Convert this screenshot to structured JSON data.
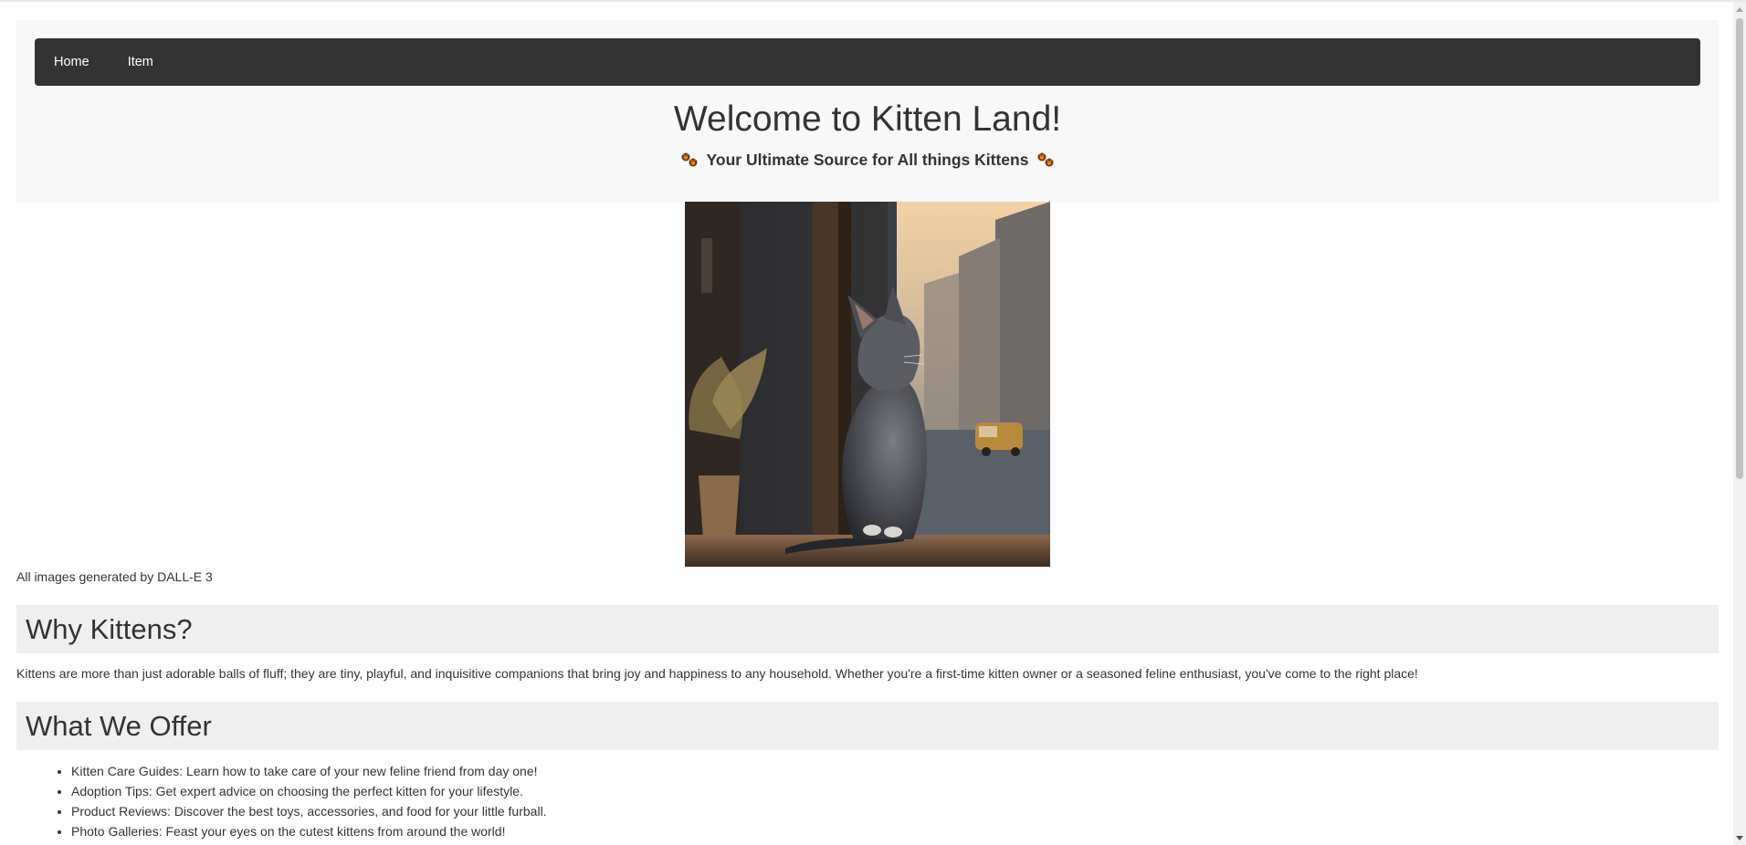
{
  "nav": {
    "items": [
      {
        "label": "Home"
      },
      {
        "label": "Item"
      }
    ]
  },
  "header": {
    "title": "Welcome to Kitten Land!",
    "tagline": "Your Ultimate Source for All things Kittens"
  },
  "hero": {
    "credit": "All images generated by DALL-E 3"
  },
  "why": {
    "heading": "Why Kittens?",
    "text": "Kittens are more than just adorable balls of fluff; they are tiny, playful, and inquisitive companions that bring joy and happiness to any household. Whether you're a first-time kitten owner or a seasoned feline enthusiast, you've come to the right place!"
  },
  "offer": {
    "heading": "What We Offer",
    "items": [
      "Kitten Care Guides: Learn how to take care of your new feline friend from day one!",
      "Adoption Tips: Get expert advice on choosing the perfect kitten for your lifestyle.",
      "Product Reviews: Discover the best toys, accessories, and food for your little furball.",
      "Photo Galleries: Feast your eyes on the cutest kittens from around the world!"
    ]
  },
  "colors": {
    "navbar": "#333333",
    "header_bg": "#f8f8f8",
    "section_bg": "#efefef",
    "text": "#333333"
  },
  "icons": [
    "paw-prints-icon"
  ]
}
